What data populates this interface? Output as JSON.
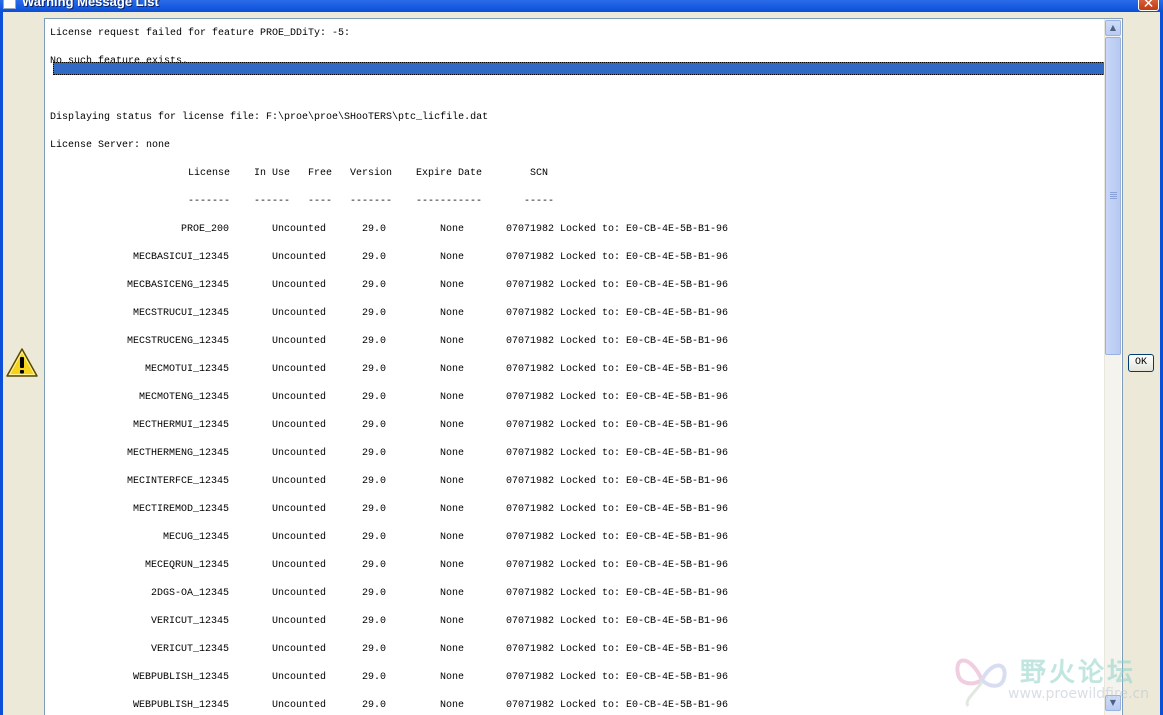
{
  "window": {
    "title": "Warning Message List",
    "close_glyph": "✕"
  },
  "messages": {
    "line1": "License request failed for feature PROE_DDiTy: -5:",
    "line2": "No such feature exists.",
    "line3": "Displaying status for license file: F:\\proe\\proe\\SHooTERS\\ptc_licfile.dat",
    "line4": "License Server: none"
  },
  "table": {
    "headers": {
      "license": "License",
      "in_use": "In Use",
      "free": "Free",
      "version": "Version",
      "expire": "Expire Date",
      "scn": "SCN"
    },
    "separators": {
      "license": "-------",
      "in_use": "------",
      "free": "----",
      "version": "-------",
      "expire": "-----------",
      "scn": "-----"
    },
    "rows": [
      {
        "license": "PROE_200",
        "in_use": "Uncounted",
        "version": "29.0",
        "expire": "None",
        "scn": "07071982",
        "lock": "Locked to: E0-CB-4E-5B-B1-96"
      },
      {
        "license": "MECBASICUI_12345",
        "in_use": "Uncounted",
        "version": "29.0",
        "expire": "None",
        "scn": "07071982",
        "lock": "Locked to: E0-CB-4E-5B-B1-96"
      },
      {
        "license": "MECBASICENG_12345",
        "in_use": "Uncounted",
        "version": "29.0",
        "expire": "None",
        "scn": "07071982",
        "lock": "Locked to: E0-CB-4E-5B-B1-96"
      },
      {
        "license": "MECSTRUCUI_12345",
        "in_use": "Uncounted",
        "version": "29.0",
        "expire": "None",
        "scn": "07071982",
        "lock": "Locked to: E0-CB-4E-5B-B1-96"
      },
      {
        "license": "MECSTRUCENG_12345",
        "in_use": "Uncounted",
        "version": "29.0",
        "expire": "None",
        "scn": "07071982",
        "lock": "Locked to: E0-CB-4E-5B-B1-96"
      },
      {
        "license": "MECMOTUI_12345",
        "in_use": "Uncounted",
        "version": "29.0",
        "expire": "None",
        "scn": "07071982",
        "lock": "Locked to: E0-CB-4E-5B-B1-96"
      },
      {
        "license": "MECMOTENG_12345",
        "in_use": "Uncounted",
        "version": "29.0",
        "expire": "None",
        "scn": "07071982",
        "lock": "Locked to: E0-CB-4E-5B-B1-96"
      },
      {
        "license": "MECTHERMUI_12345",
        "in_use": "Uncounted",
        "version": "29.0",
        "expire": "None",
        "scn": "07071982",
        "lock": "Locked to: E0-CB-4E-5B-B1-96"
      },
      {
        "license": "MECTHERMENG_12345",
        "in_use": "Uncounted",
        "version": "29.0",
        "expire": "None",
        "scn": "07071982",
        "lock": "Locked to: E0-CB-4E-5B-B1-96"
      },
      {
        "license": "MECINTERFCE_12345",
        "in_use": "Uncounted",
        "version": "29.0",
        "expire": "None",
        "scn": "07071982",
        "lock": "Locked to: E0-CB-4E-5B-B1-96"
      },
      {
        "license": "MECTIREMOD_12345",
        "in_use": "Uncounted",
        "version": "29.0",
        "expire": "None",
        "scn": "07071982",
        "lock": "Locked to: E0-CB-4E-5B-B1-96"
      },
      {
        "license": "MECUG_12345",
        "in_use": "Uncounted",
        "version": "29.0",
        "expire": "None",
        "scn": "07071982",
        "lock": "Locked to: E0-CB-4E-5B-B1-96"
      },
      {
        "license": "MECEQRUN_12345",
        "in_use": "Uncounted",
        "version": "29.0",
        "expire": "None",
        "scn": "07071982",
        "lock": "Locked to: E0-CB-4E-5B-B1-96"
      },
      {
        "license": "2DGS-OA_12345",
        "in_use": "Uncounted",
        "version": "29.0",
        "expire": "None",
        "scn": "07071982",
        "lock": "Locked to: E0-CB-4E-5B-B1-96"
      },
      {
        "license": "VERICUT_12345",
        "in_use": "Uncounted",
        "version": "29.0",
        "expire": "None",
        "scn": "07071982",
        "lock": "Locked to: E0-CB-4E-5B-B1-96"
      },
      {
        "license": "VERICUT_12345",
        "in_use": "Uncounted",
        "version": "29.0",
        "expire": "None",
        "scn": "07071982",
        "lock": "Locked to: E0-CB-4E-5B-B1-96"
      },
      {
        "license": "WEBPUBLISH_12345",
        "in_use": "Uncounted",
        "version": "29.0",
        "expire": "None",
        "scn": "07071982",
        "lock": "Locked to: E0-CB-4E-5B-B1-96"
      },
      {
        "license": "WEBPUBLISH_12345",
        "in_use": "Uncounted",
        "version": "29.0",
        "expire": "None",
        "scn": "07071982",
        "lock": "Locked to: E0-CB-4E-5B-B1-96"
      }
    ]
  },
  "buttons": {
    "ok_label": "OK"
  },
  "icons": {
    "warning": "warning-icon",
    "scroll_up": "scroll-up-icon",
    "scroll_down": "scroll-down-icon"
  },
  "watermark": {
    "text": "野火论坛",
    "url": "www.proewildfire.cn"
  },
  "colors": {
    "titlebar": "#0a4fd6",
    "selection": "#316ac5",
    "dialog_bg": "#ece9d8",
    "close_button": "#c13a12"
  }
}
